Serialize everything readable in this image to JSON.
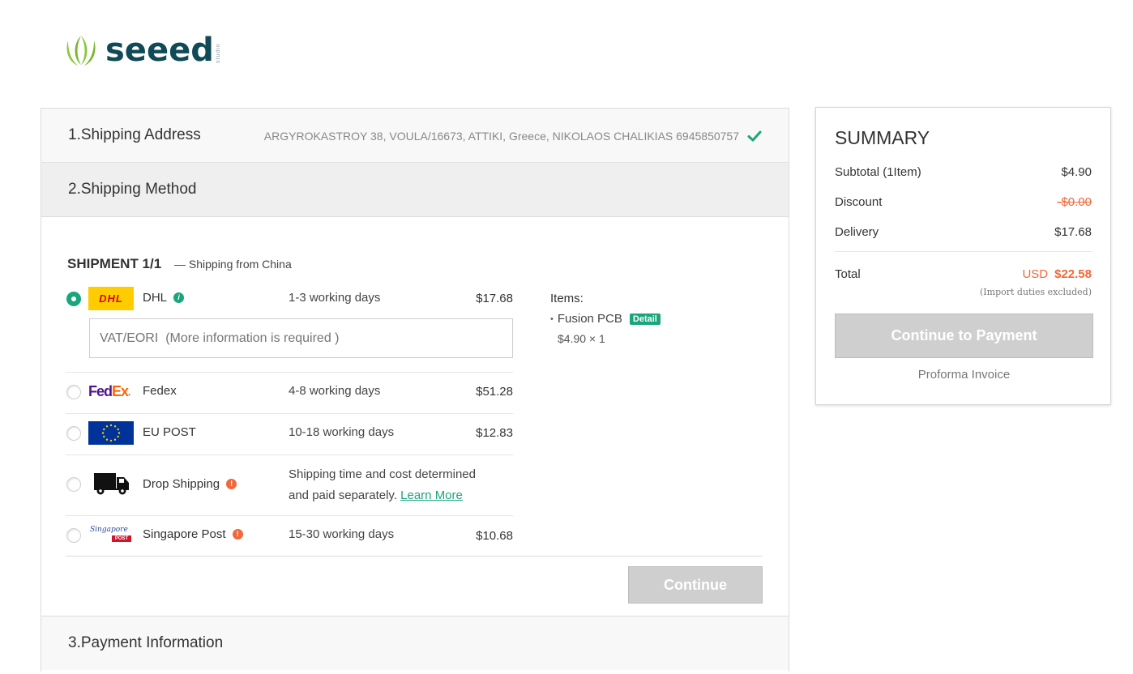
{
  "logo": {
    "wordmark": "seeed",
    "tagline": "studio"
  },
  "steps": {
    "shipping_address": {
      "label": "1.Shipping Address",
      "value": "ARGYROKASTROY 38, VOULA/16673, ATTIKI, Greece, NIKOLAOS CHALIKIAS 6945850757"
    },
    "shipping_method": {
      "label": "2.Shipping Method"
    },
    "payment_info": {
      "label": "3.Payment Information"
    }
  },
  "shipment": {
    "title": "SHIPMENT 1/1",
    "subtitle": "— Shipping from China",
    "vat_placeholder": "VAT/EORI  (More information is required )",
    "options": [
      {
        "carrier": "DHL",
        "logo_text": "DHL",
        "days": "1-3 working days",
        "price": "$17.68",
        "selected": true,
        "info": "i"
      },
      {
        "carrier": "Fedex",
        "logo_text_a": "Fed",
        "logo_text_b": "Ex",
        "days": "4-8 working days",
        "price": "$51.28",
        "selected": false
      },
      {
        "carrier": "EU POST",
        "days": "10-18 working days",
        "price": "$12.83",
        "selected": false
      },
      {
        "carrier": "Drop Shipping",
        "days_line1": "Shipping time and cost determined",
        "days_line2": "and paid separately.",
        "learn_more": "Learn More",
        "selected": false,
        "info": "!"
      },
      {
        "carrier": "Singapore Post",
        "logo_text_a": "Singapore",
        "logo_text_b": "POST",
        "days": "15-30 working days",
        "price": "$10.68",
        "selected": false,
        "info": "!"
      }
    ],
    "items_label": "Items:",
    "item_bullet": "•",
    "item_name": "Fusion PCB",
    "item_badge": "Detail",
    "item_price": "$4.90 × 1",
    "continue_label": "Continue"
  },
  "summary": {
    "title": "SUMMARY",
    "rows": [
      {
        "label": "Subtotal (1Item)",
        "value": "$4.90"
      },
      {
        "label": "Discount",
        "value": "-$0.00"
      },
      {
        "label": "Delivery",
        "value": "$17.68"
      }
    ],
    "total_label": "Total",
    "total_currency": "USD",
    "total_value": "$22.58",
    "duties_note": "(Import duties excluded)",
    "pay_button": "Continue to Payment",
    "proforma": "Proforma Invoice"
  },
  "colors": {
    "accent": "#1aa57c",
    "highlight": "#f2683a",
    "brand": "#0f4a56",
    "logo_leaf": "#7ab52e"
  }
}
